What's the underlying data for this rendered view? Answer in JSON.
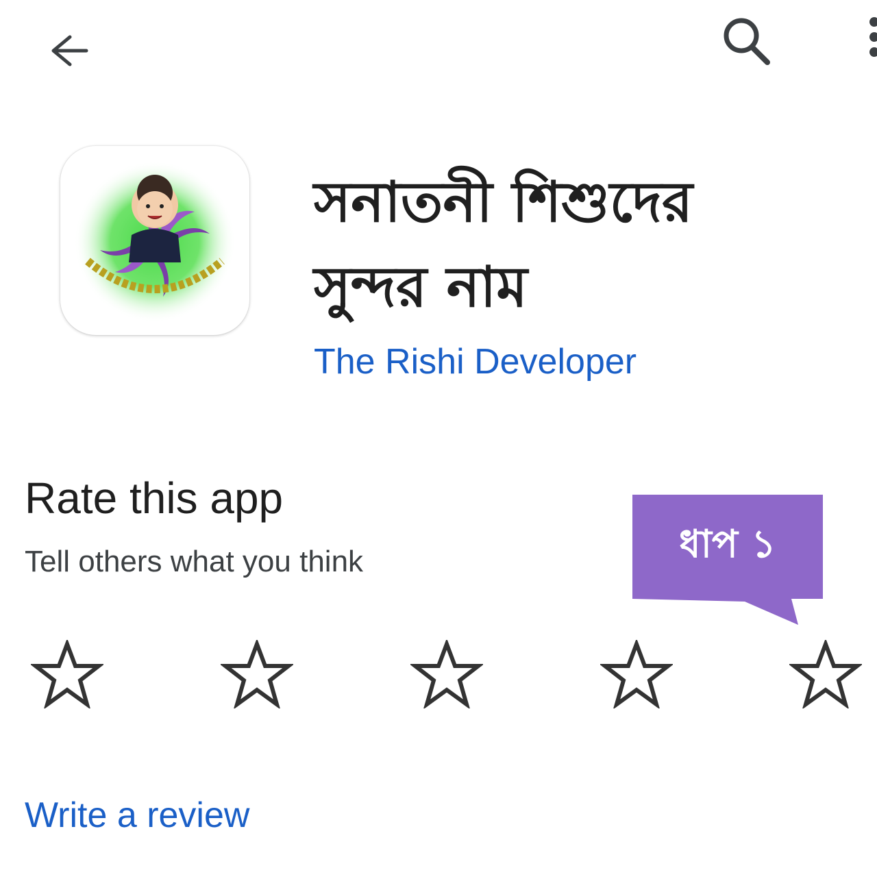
{
  "header": {
    "back_icon": "arrow-back-icon",
    "search_icon": "search-icon",
    "more_icon": "more-vert-icon"
  },
  "app": {
    "title": "সনাতনী শিশুদের সুন্দর নাম",
    "developer": "The Rishi Developer",
    "icon": "app-logo-icon",
    "icon_logo_text": "সনাতনী শিশুদের সুন্দর নাম"
  },
  "rating": {
    "heading": "Rate this app",
    "subtitle": "Tell others what you think",
    "stars_selected": 0,
    "stars_total": 5,
    "star_icon": "star-outline-icon"
  },
  "callout": {
    "text": "ধাপ ১",
    "color": "#8e68c9"
  },
  "review": {
    "link": "Write a review"
  },
  "colors": {
    "link": "#1a5fc7",
    "text": "#1f1f1f",
    "star_outline": "#333333"
  }
}
